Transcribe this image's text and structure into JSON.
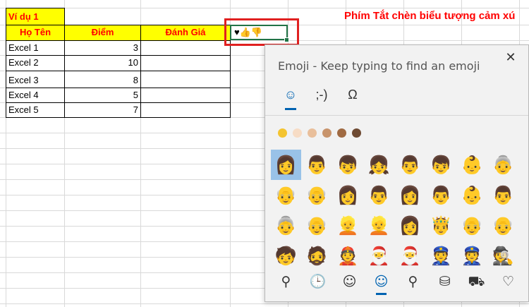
{
  "sheet": {
    "title": "Phím Tắt chèn biểu tượng cảm xú",
    "example_label": "Ví dụ 1",
    "headers": [
      "Họ Tên",
      "Điểm",
      "Đánh Giá"
    ],
    "rows": [
      {
        "name": "Excel 1",
        "score": "3",
        "rating": ""
      },
      {
        "name": "Excel 2",
        "score": "10",
        "rating": ""
      },
      {
        "name": "Excel 3",
        "score": "8",
        "rating": ""
      },
      {
        "name": "Excel 4",
        "score": "5",
        "rating": ""
      },
      {
        "name": "Excel 5",
        "score": "7",
        "rating": ""
      }
    ],
    "active_cell_value": "♥👍👎",
    "colors": {
      "header_fill": "#ffff00",
      "header_text": "#ff0000",
      "title_text": "#ff0000",
      "highlight_box": "#e02020",
      "selection": "#217346"
    }
  },
  "emoji_panel": {
    "heading": "Emoji - Keep typing to find an emoji",
    "close_glyph": "✕",
    "tabs": [
      {
        "glyph": "☺",
        "icon": "smiley-tab-icon"
      },
      {
        "glyph": ";-)",
        "icon": "kaomoji-tab-icon"
      },
      {
        "glyph": "Ω",
        "icon": "symbols-tab-icon"
      }
    ],
    "skin_tones": [
      "#f4c430",
      "#f7dcc5",
      "#e9bf9b",
      "#c8946c",
      "#a06a42",
      "#6e4a32"
    ],
    "emoji_rows": [
      [
        "👩",
        "👨",
        "👦",
        "👧",
        "👨",
        "👦",
        "👶",
        "👵"
      ],
      [
        "👴",
        "👴",
        "👩",
        "👨",
        "👩",
        "👨",
        "👶",
        "👨"
      ],
      [
        "👵",
        "👴",
        "👱",
        "👱",
        "👩",
        "🤴",
        "👴",
        "👴"
      ],
      [
        "🧒",
        "🧔",
        "👲",
        "🎅",
        "🎅",
        "👮",
        "👮",
        "🕵"
      ]
    ],
    "categories": [
      {
        "glyph": "⚲",
        "icon": "search-icon"
      },
      {
        "glyph": "🕒",
        "icon": "recent-clock-icon"
      },
      {
        "glyph": "☺",
        "icon": "smiley-category-icon"
      },
      {
        "glyph": "☺",
        "icon": "people-category-icon"
      },
      {
        "glyph": "⚲",
        "icon": "celebration-balloon-icon"
      },
      {
        "glyph": "⛁",
        "icon": "food-category-icon"
      },
      {
        "glyph": "⛟",
        "icon": "car-category-icon"
      },
      {
        "glyph": "♡",
        "icon": "heart-category-icon"
      }
    ]
  }
}
